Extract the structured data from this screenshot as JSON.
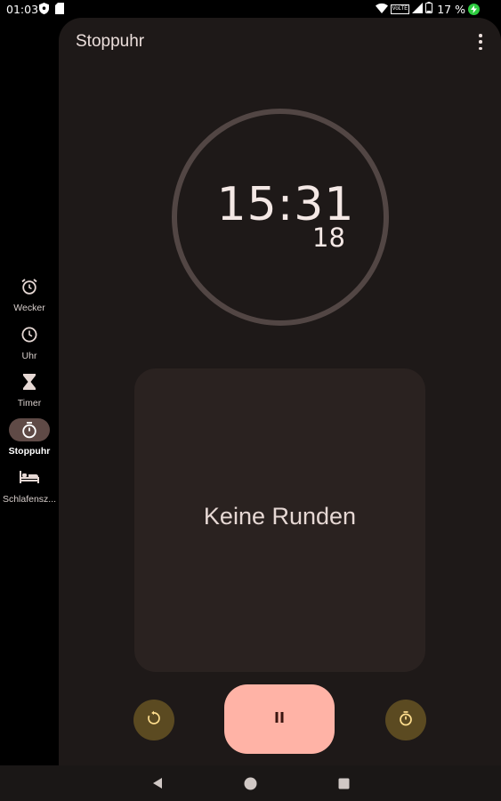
{
  "status_bar": {
    "time": "01:03",
    "volte": "VoLTE",
    "battery_percent": "17 %"
  },
  "rail": {
    "items": [
      {
        "label": "Wecker",
        "icon": "alarm-icon"
      },
      {
        "label": "Uhr",
        "icon": "clock-icon"
      },
      {
        "label": "Timer",
        "icon": "hourglass-icon"
      },
      {
        "label": "Stoppuhr",
        "icon": "stopwatch-icon",
        "active": true
      },
      {
        "label": "Schlafensz...",
        "icon": "bed-icon"
      }
    ]
  },
  "header": {
    "title": "Stoppuhr"
  },
  "stopwatch": {
    "time": "15:31",
    "hundredths": "18"
  },
  "laps": {
    "empty_text": "Keine Runden"
  },
  "colors": {
    "surface": "#1e1918",
    "laps_card": "#2a2220",
    "dial_ring": "#524644",
    "pause_button": "#ffb3a6",
    "secondary_button": "#5b4a21",
    "accent_icon": "#ffdf8f",
    "rail_active_pill": "#5f4a46"
  }
}
